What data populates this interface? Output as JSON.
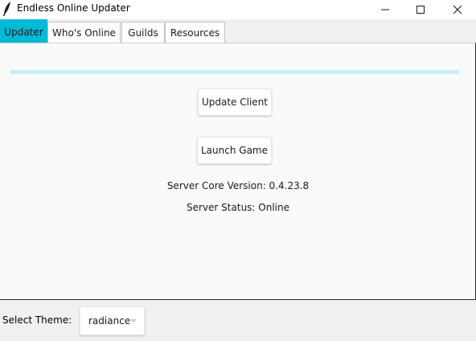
{
  "window": {
    "title": "Endless Online Updater",
    "icons": {
      "app": "feather-icon",
      "minimize": "minimize-icon",
      "maximize": "maximize-icon",
      "close": "close-icon"
    }
  },
  "tabs": [
    {
      "label": "Updater",
      "active": true
    },
    {
      "label": "Who's Online",
      "active": false
    },
    {
      "label": "Guilds",
      "active": false
    },
    {
      "label": "Resources",
      "active": false
    }
  ],
  "updater": {
    "progress": 0,
    "update_button": "Update Client",
    "launch_button": "Launch Game",
    "server_version": "Server Core Version: 0.4.23.8",
    "server_status": "Server Status: Online"
  },
  "theme": {
    "label": "Select Theme:",
    "selected": "radiance"
  },
  "colors": {
    "accent": "#00b9d6",
    "progress_track": "#c9ecf2",
    "panel_background": "#f8fafc"
  }
}
